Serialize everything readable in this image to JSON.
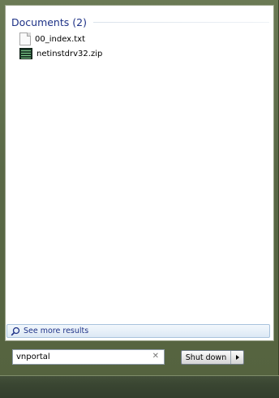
{
  "results": {
    "group_title": "Documents (2)",
    "items": [
      {
        "label": "00_index.txt",
        "icon": "text-file-icon"
      },
      {
        "label": "netinstdrv32.zip",
        "icon": "zip-file-icon"
      }
    ]
  },
  "see_more": {
    "label": "See more results",
    "icon": "search-icon"
  },
  "search": {
    "value": "vnportal",
    "clear_icon": "close-icon"
  },
  "shutdown": {
    "label": "Shut down",
    "arrow_icon": "chevron-right-icon"
  }
}
